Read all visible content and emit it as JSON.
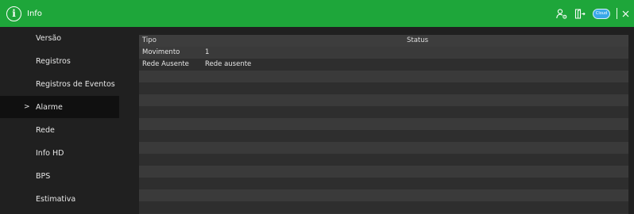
{
  "header": {
    "title": "Info",
    "cloud_badge": "Cloud"
  },
  "sidebar": {
    "items": [
      {
        "label": "Versão"
      },
      {
        "label": "Registros"
      },
      {
        "label": "Registros de Eventos"
      },
      {
        "label": "Alarme",
        "active": true
      },
      {
        "label": "Rede"
      },
      {
        "label": "Info HD"
      },
      {
        "label": "BPS"
      },
      {
        "label": "Estimativa"
      }
    ],
    "active_marker": ">"
  },
  "table": {
    "columns": [
      "Tipo",
      "Status"
    ],
    "rows": [
      {
        "tipo": "Movimento",
        "status": "1"
      },
      {
        "tipo": "Rede Ausente",
        "status": "Rede ausente"
      }
    ]
  },
  "colors": {
    "accent": "#1ea63a",
    "background": "#202020",
    "panel": "#333333"
  }
}
